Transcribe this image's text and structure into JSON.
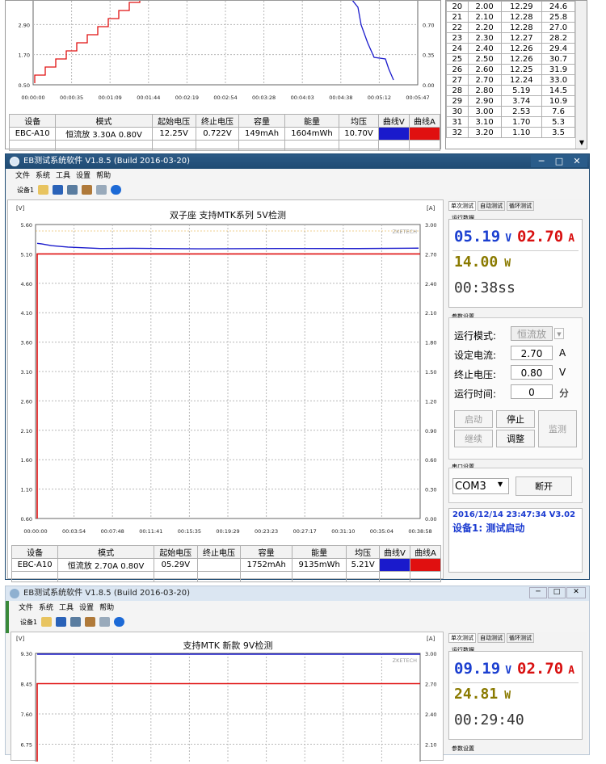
{
  "top_window": {
    "chart": {
      "y_left_ticks": [
        "2.90",
        "1.70",
        "0.50"
      ],
      "y_right_ticks": [
        "0.70",
        "0.35",
        "0.00"
      ],
      "x_ticks": [
        "00:00:00",
        "00:00:35",
        "00:01:09",
        "00:01:44",
        "00:02:19",
        "00:02:54",
        "00:03:28",
        "00:04:03",
        "00:04:38",
        "00:05:12",
        "00:05:47"
      ]
    },
    "summary": {
      "headers": [
        "设备",
        "模式",
        "起始电压",
        "终止电压",
        "容量",
        "能量",
        "均压",
        "曲线V",
        "曲线A"
      ],
      "row": [
        "EBC-A10",
        "恒流放 3.30A 0.80V",
        "12.25V",
        "0.722V",
        "149mAh",
        "1604mWh",
        "10.70V",
        "",
        ""
      ]
    },
    "data_table": [
      [
        "20",
        "2.00",
        "12.29",
        "24.6"
      ],
      [
        "21",
        "2.10",
        "12.28",
        "25.8"
      ],
      [
        "22",
        "2.20",
        "12.28",
        "27.0"
      ],
      [
        "23",
        "2.30",
        "12.27",
        "28.2"
      ],
      [
        "24",
        "2.40",
        "12.26",
        "29.4"
      ],
      [
        "25",
        "2.50",
        "12.26",
        "30.7"
      ],
      [
        "26",
        "2.60",
        "12.25",
        "31.9"
      ],
      [
        "27",
        "2.70",
        "12.24",
        "33.0"
      ],
      [
        "28",
        "2.80",
        "5.19",
        "14.5"
      ],
      [
        "29",
        "2.90",
        "3.74",
        "10.9"
      ],
      [
        "30",
        "3.00",
        "2.53",
        "7.6"
      ],
      [
        "31",
        "3.10",
        "1.70",
        "5.3"
      ],
      [
        "32",
        "3.20",
        "1.10",
        "3.5"
      ]
    ]
  },
  "mid_window": {
    "title": "EB测试系统软件 V1.8.5 (Build 2016-03-20)",
    "menu": [
      "文件",
      "系统",
      "工具",
      "设置",
      "帮助"
    ],
    "device_label": "设备1",
    "chart": {
      "title": "双子座 支持MTK系列 5V检测",
      "watermark": "ZKETECH",
      "y_left_unit": "[V]",
      "y_right_unit": "[A]",
      "y_left_ticks": [
        "5.60",
        "5.10",
        "4.60",
        "4.10",
        "3.60",
        "3.10",
        "2.60",
        "2.10",
        "1.60",
        "1.10",
        "0.60"
      ],
      "y_right_ticks": [
        "3.00",
        "2.70",
        "2.40",
        "2.10",
        "1.80",
        "1.50",
        "1.20",
        "0.90",
        "0.60",
        "0.30",
        "0.00"
      ],
      "x_ticks": [
        "00:00:00",
        "00:03:54",
        "00:07:48",
        "00:11:41",
        "00:15:35",
        "00:19:29",
        "00:23:23",
        "00:27:17",
        "00:31:10",
        "00:35:04",
        "00:38:58"
      ]
    },
    "summary": {
      "headers": [
        "设备",
        "模式",
        "起始电压",
        "终止电压",
        "容量",
        "能量",
        "均压",
        "曲线V",
        "曲线A"
      ],
      "row": [
        "EBC-A10",
        "恒流放 2.70A 0.80V",
        "05.29V",
        "",
        "1752mAh",
        "9135mWh",
        "5.21V",
        "",
        ""
      ]
    },
    "panel": {
      "tabs": [
        "单次测试",
        "自动测试",
        "循环测试"
      ],
      "run_data_label": "运行数据",
      "voltage": "05.19",
      "voltage_unit": "V",
      "current": "02.70",
      "current_unit": "A",
      "power": "14.00",
      "power_unit": "W",
      "time": "00:38ss",
      "param_label": "参数设置",
      "mode_label": "运行模式:",
      "mode_value": "恒流放",
      "set_current_label": "设定电流:",
      "set_current_value": "2.70",
      "set_current_unit": "A",
      "stop_voltage_label": "终止电压:",
      "stop_voltage_value": "0.80",
      "stop_voltage_unit": "V",
      "run_time_label": "运行时间:",
      "run_time_value": "0",
      "run_time_unit": "分",
      "btn_start": "启动",
      "btn_stop": "停止",
      "btn_monitor": "监测",
      "btn_continue": "继续",
      "btn_adjust": "调整",
      "com_label": "串口设置",
      "com_value": "COM3",
      "btn_disconnect": "断开",
      "log_time": "2016/12/14 23:47:34  V3.02",
      "log_msg": "设备1: 测试启动"
    }
  },
  "bottom_window": {
    "title": "EB测试系统软件 V1.8.5 (Build 2016-03-20)",
    "menu": [
      "文件",
      "系统",
      "工具",
      "设置",
      "帮助"
    ],
    "device_label": "设备1",
    "chart": {
      "title": "支持MTK 新款  9V检测",
      "watermark": "ZKETECH",
      "y_left_unit": "[V]",
      "y_right_unit": "[A]",
      "y_left_ticks": [
        "9.30",
        "8.45",
        "7.60",
        "6.75"
      ],
      "y_right_ticks": [
        "3.00",
        "2.70",
        "2.40",
        "2.10"
      ]
    },
    "panel": {
      "tabs": [
        "单次测试",
        "自动测试",
        "循环测试"
      ],
      "run_data_label": "运行数据",
      "voltage": "09.19",
      "voltage_unit": "V",
      "current": "02.70",
      "current_unit": "A",
      "power": "24.81",
      "power_unit": "W",
      "time": "00:29:40",
      "param_label": "参数设置"
    }
  },
  "colors": {
    "curve_v": "#1a1acc",
    "curve_a": "#e01010",
    "title_bar": "#1f4b73",
    "lcd_v": "#1b3fd0",
    "lcd_a": "#d81010",
    "lcd_w": "#8a7a00"
  }
}
